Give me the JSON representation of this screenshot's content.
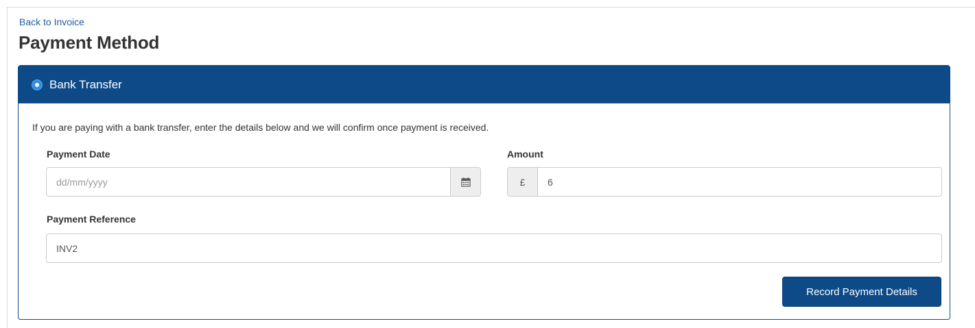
{
  "nav": {
    "back_label": "Back to Invoice"
  },
  "page": {
    "title": "Payment Method"
  },
  "panel": {
    "method_label": "Bank Transfer",
    "method_selected": true,
    "intro": "If you are paying with a bank transfer, enter the details below and we will confirm once payment is received.",
    "icons": {
      "radio": "radio-selected-icon",
      "date": "calendar-icon",
      "currency": "pound-sign-icon"
    },
    "payment_date": {
      "label": "Payment Date",
      "value": "",
      "placeholder": "dd/mm/yyyy"
    },
    "amount": {
      "label": "Amount",
      "currency_symbol": "£",
      "value": "6"
    },
    "payment_reference": {
      "label": "Payment Reference",
      "value": "INV2"
    },
    "submit_label": "Record Payment Details"
  },
  "colors": {
    "primary": "#0d4a87",
    "link": "#1f5fa0",
    "radio_selected": "#2f8ee6"
  }
}
